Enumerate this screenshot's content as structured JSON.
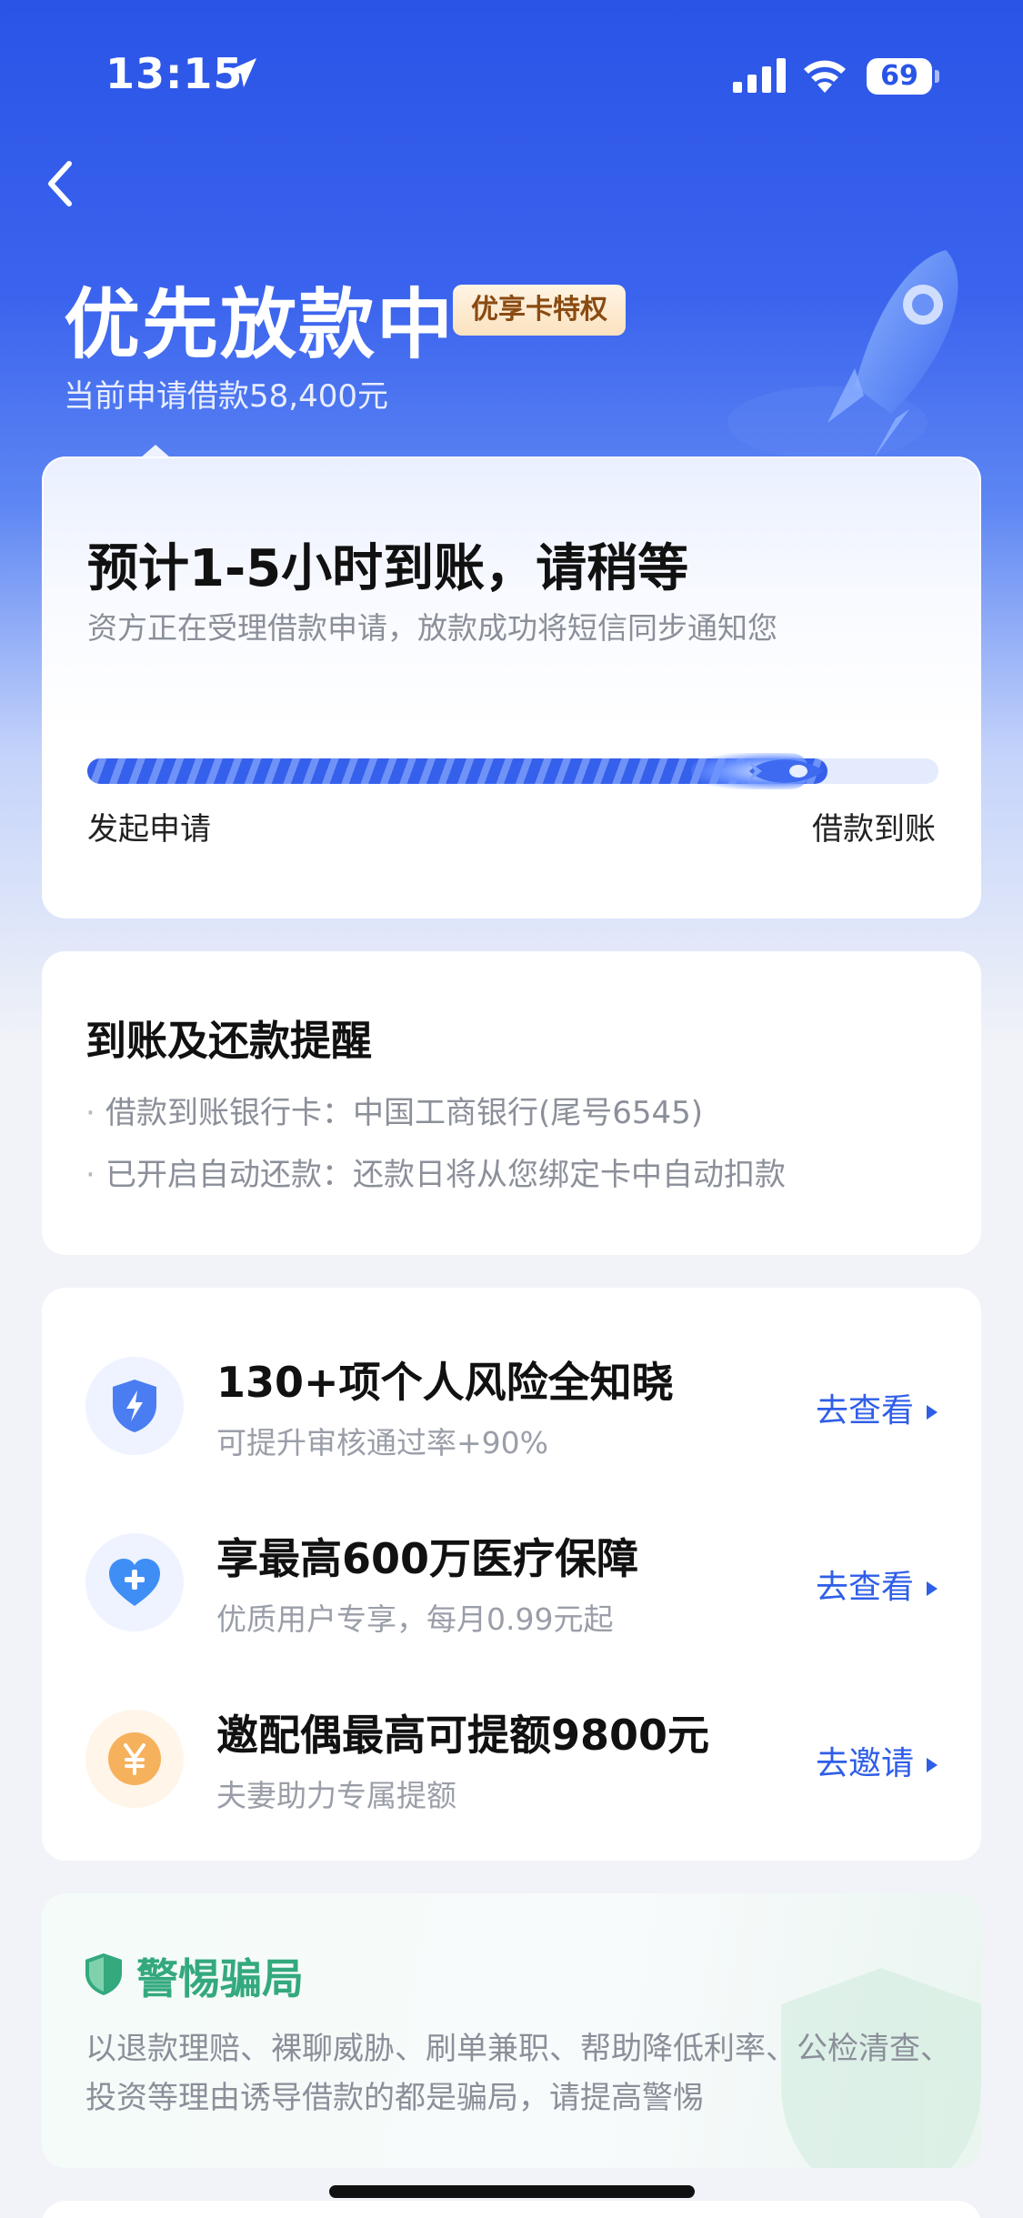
{
  "status_bar": {
    "time": "13:15",
    "battery": "69"
  },
  "header": {
    "title": "优先放款中",
    "badge": "优享卡特权",
    "subtitle": "当前申请借款58,400元"
  },
  "progress_card": {
    "heading": "预计1-5小时到账，请稍等",
    "description": "资方正在受理借款申请，放款成功将短信同步通知您",
    "start_label": "发起申请",
    "end_label": "借款到账",
    "progress": 0.87
  },
  "reminder_card": {
    "title": "到账及还款提醒",
    "lines": [
      "借款到账银行卡：中国工商银行(尾号6545)",
      "已开启自动还款：还款日将从您绑定卡中自动扣款"
    ]
  },
  "services": [
    {
      "icon": "shield-bolt-icon",
      "title": "130+项个人风险全知晓",
      "subtitle": "可提升审核通过率+90%",
      "action": "去查看"
    },
    {
      "icon": "heart-plus-icon",
      "title": "享最高600万医疗保障",
      "subtitle": "优质用户专享，每月0.99元起",
      "action": "去查看"
    },
    {
      "icon": "yuan-coin-icon",
      "title": "邀配偶最高可提额9800元",
      "subtitle": "夫妻助力专属提额",
      "action": "去邀请"
    }
  ],
  "fraud_card": {
    "title": "警惕骗局",
    "text": "以退款理赔、裸聊威胁、刷单兼职、帮助降低利率、公检清查、投资等理由诱导借款的都是骗局，请提高警惕"
  },
  "colors": {
    "brand_blue": "#2a54e6",
    "link_blue": "#2f5ee8",
    "warning_green": "#33a97d",
    "badge_brown": "#8a4b12"
  }
}
